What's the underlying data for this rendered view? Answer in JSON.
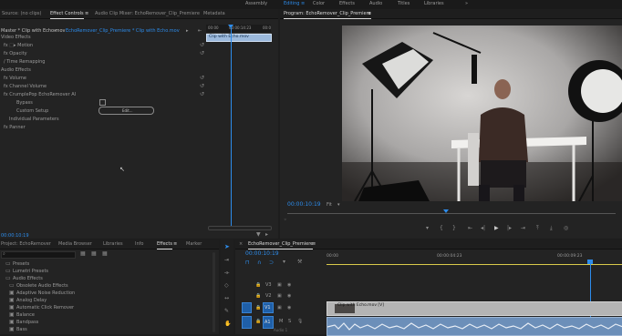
{
  "workspaces": {
    "assembly": "Assembly",
    "editing": "Editing",
    "color": "Color",
    "effects": "Effects",
    "audio": "Audio",
    "titles": "Titles",
    "libraries": "Libraries",
    "more": "»"
  },
  "source_panel": {
    "tabs": [
      "Source: (no clips)",
      "Effect Controls",
      "Audio Clip Mixer: EchoRemover_Clip_Premiere",
      "Metadata"
    ],
    "menu_icon": "≡",
    "crumb_master": "Master * Clip with Echo.mov",
    "crumb_seq": "EchoRemover_Clip_Premiere * Clip with Echo.mov",
    "ruler": {
      "t0": "00:00",
      "t1": "00:00:14:23",
      "t2": "00:0"
    },
    "clip_label": "Clip with Echo.mov",
    "rows": [
      {
        "label": "Video Effects",
        "type": "section"
      },
      {
        "label": "fx  ⬚▸ Motion",
        "type": "effect"
      },
      {
        "label": "fx  Opacity",
        "type": "effect"
      },
      {
        "label": "/  Time Remapping",
        "type": "effect"
      },
      {
        "label": "Audio Effects",
        "type": "section"
      },
      {
        "label": "fx  Volume",
        "type": "effect"
      },
      {
        "label": "fx  Channel Volume",
        "type": "effect"
      },
      {
        "label": "fx  CrumplePop EchoRemover AI",
        "type": "effect"
      },
      {
        "label": "Bypass",
        "type": "param"
      },
      {
        "label": "Custom Setup",
        "type": "param"
      },
      {
        "label": "Individual Parameters",
        "type": "param"
      },
      {
        "label": "fx  Panner",
        "type": "effect"
      }
    ],
    "edit_button": "Edit...",
    "timecode": "00:00:10:19"
  },
  "program_monitor": {
    "title": "Program: EchoRemover_Clip_Premiere",
    "timecode": "00:00:10:19",
    "zoom": "Fit",
    "transport_icons": [
      "marker-icon",
      "in-point-icon",
      "out-point-icon",
      "go-to-in-icon",
      "step-back-icon",
      "play-icon",
      "step-forward-icon",
      "go-to-out-icon",
      "lift-icon",
      "extract-icon",
      "export-frame-icon"
    ],
    "transport_glyphs": [
      "▾",
      "{",
      "}",
      "⇤",
      "◂|",
      "▶",
      "|▸",
      "⇥",
      "⤒",
      "⤓",
      "◎"
    ]
  },
  "project_panel": {
    "tabs": [
      "Project: EchoRemover",
      "Media Browser",
      "Libraries",
      "Info",
      "Effects",
      "Marker"
    ],
    "search_placeholder": "",
    "items": [
      {
        "label": "Presets",
        "indent": 0
      },
      {
        "label": "Lumetri Presets",
        "indent": 0
      },
      {
        "label": "Audio Effects",
        "indent": 0
      },
      {
        "label": "Obsolete Audio Effects",
        "indent": 1
      },
      {
        "label": "Adaptive Noise Reduction",
        "indent": 1
      },
      {
        "label": "Analog Delay",
        "indent": 1
      },
      {
        "label": "Automatic Click Remover",
        "indent": 1
      },
      {
        "label": "Balance",
        "indent": 1
      },
      {
        "label": "Bandpass",
        "indent": 1
      },
      {
        "label": "Bass",
        "indent": 1
      }
    ]
  },
  "timeline": {
    "title": "EchoRemover_Clip_Premiere",
    "timecode": "00:00:10:19",
    "ruler": {
      "t0": "00:00",
      "t1": "00:00:04:23",
      "t2": "00:00:09:23"
    },
    "tracks": [
      {
        "name": "V3"
      },
      {
        "name": "V2"
      },
      {
        "name": "V1"
      },
      {
        "name": "A1"
      }
    ],
    "video_clip_label": "Clip with Echo.mov [V]",
    "audio_track_label": "Audio 1",
    "colors": {
      "accent": "#2d8ceb",
      "video_clip": "#b4b4b4",
      "audio_clip": "#6c8fb9",
      "playhead": "#2d8ceb",
      "work_area": "#d9c94a"
    }
  }
}
